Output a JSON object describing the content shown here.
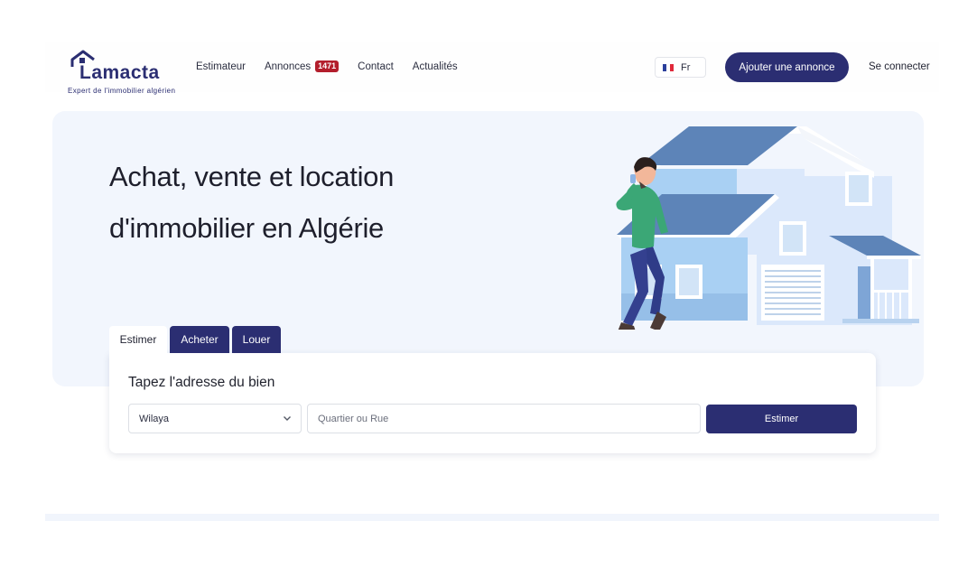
{
  "header": {
    "logo": {
      "word": "Lamacta",
      "tagline": "Expert de l'immobilier algérien"
    },
    "nav": [
      {
        "label": "Estimateur"
      },
      {
        "label": "Annonces",
        "badge": "1471"
      },
      {
        "label": "Contact"
      },
      {
        "label": "Actualités"
      }
    ],
    "language": {
      "label": "Fr",
      "flag_icon": "french-flag-icon"
    },
    "add_listing_label": "Ajouter une annonce",
    "login_label": "Se connecter"
  },
  "hero": {
    "title_line1": "Achat, vente et location",
    "title_line2": "d'immobilier en Algérie"
  },
  "search": {
    "tabs": [
      {
        "label": "Estimer",
        "active": true
      },
      {
        "label": "Acheter",
        "active": false
      },
      {
        "label": "Louer",
        "active": false
      }
    ],
    "title": "Tapez l'adresse du bien",
    "select_value": "Wilaya",
    "input_placeholder": "Quartier ou Rue",
    "submit_label": "Estimer"
  },
  "colors": {
    "brand": "#2b2e72",
    "badge": "#b31e2c",
    "hero_bg": "#f2f6fd"
  }
}
